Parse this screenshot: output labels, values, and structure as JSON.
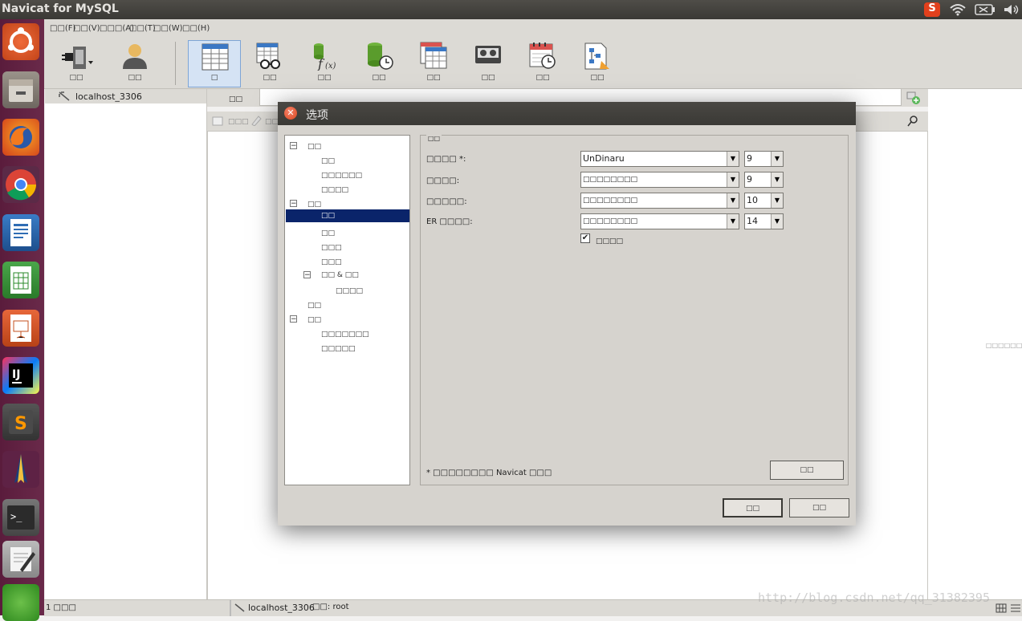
{
  "window": {
    "title": "Navicat for MySQL"
  },
  "tray": {
    "input_icon": "S",
    "wifi": "wifi-icon",
    "battery": "battery-icon",
    "volume": "volume-icon"
  },
  "menubar": [
    "□□(F)",
    "□□(V)",
    "□□□(A)",
    "□□(T)",
    "□□(W)",
    "□□(H)"
  ],
  "toolbar": [
    {
      "label": "□□"
    },
    {
      "label": "□□"
    },
    {
      "label": "□"
    },
    {
      "label": "□□"
    },
    {
      "label": "□□"
    },
    {
      "label": "□□"
    },
    {
      "label": "□□"
    },
    {
      "label": "□□"
    },
    {
      "label": "□□"
    },
    {
      "label": "□□"
    }
  ],
  "navigator": {
    "connection": "localhost_3306"
  },
  "objects": {
    "tab": "□□",
    "tool1": "□□□",
    "tool2": "□□"
  },
  "right_pane": {
    "note": "□□□□□□□"
  },
  "statusbar": {
    "count": "1 □□□",
    "connection": "localhost_3306",
    "user": "□□: root"
  },
  "watermark": "http://blog.csdn.net/qq_31382395",
  "dialog": {
    "title": "选项",
    "tree": [
      {
        "label": "□□",
        "level": 0,
        "expander": "⊟"
      },
      {
        "label": "□□",
        "level": 1
      },
      {
        "label": "□□□□□□",
        "level": 1
      },
      {
        "label": "□□□□",
        "level": 1
      },
      {
        "label": "□□",
        "level": 0,
        "expander": "⊟"
      },
      {
        "label": "□□",
        "level": 1,
        "selected": true
      },
      {
        "label": "□□",
        "level": 1
      },
      {
        "label": "□□□",
        "level": 1
      },
      {
        "label": "□□□",
        "level": 1
      },
      {
        "label": "□□ & □□",
        "level": 1,
        "expander": "⊟"
      },
      {
        "label": "□□□□",
        "level": 2
      },
      {
        "label": "□□",
        "level": 0
      },
      {
        "label": "□□",
        "level": 0,
        "expander": "⊟"
      },
      {
        "label": "□□□□□□□",
        "level": 1
      },
      {
        "label": "□□□□□",
        "level": 1
      }
    ],
    "group_title": "□□",
    "fields": [
      {
        "label": "□□□□ *:",
        "font": "UnDinaru",
        "size": "9"
      },
      {
        "label": "□□□□:",
        "font": "□□□□□□□□",
        "size": "9"
      },
      {
        "label": "□□□□□:",
        "font": "□□□□□□□□",
        "size": "10"
      },
      {
        "label": "ER □□□□:",
        "font": "□□□□□□□□",
        "size": "14"
      }
    ],
    "checkbox": {
      "label": "□□□□",
      "checked": true
    },
    "footnote": "* □□□□□□□□ Navicat □□□",
    "reset_button": "□□",
    "ok_button": "□□",
    "cancel_button": "□□"
  }
}
